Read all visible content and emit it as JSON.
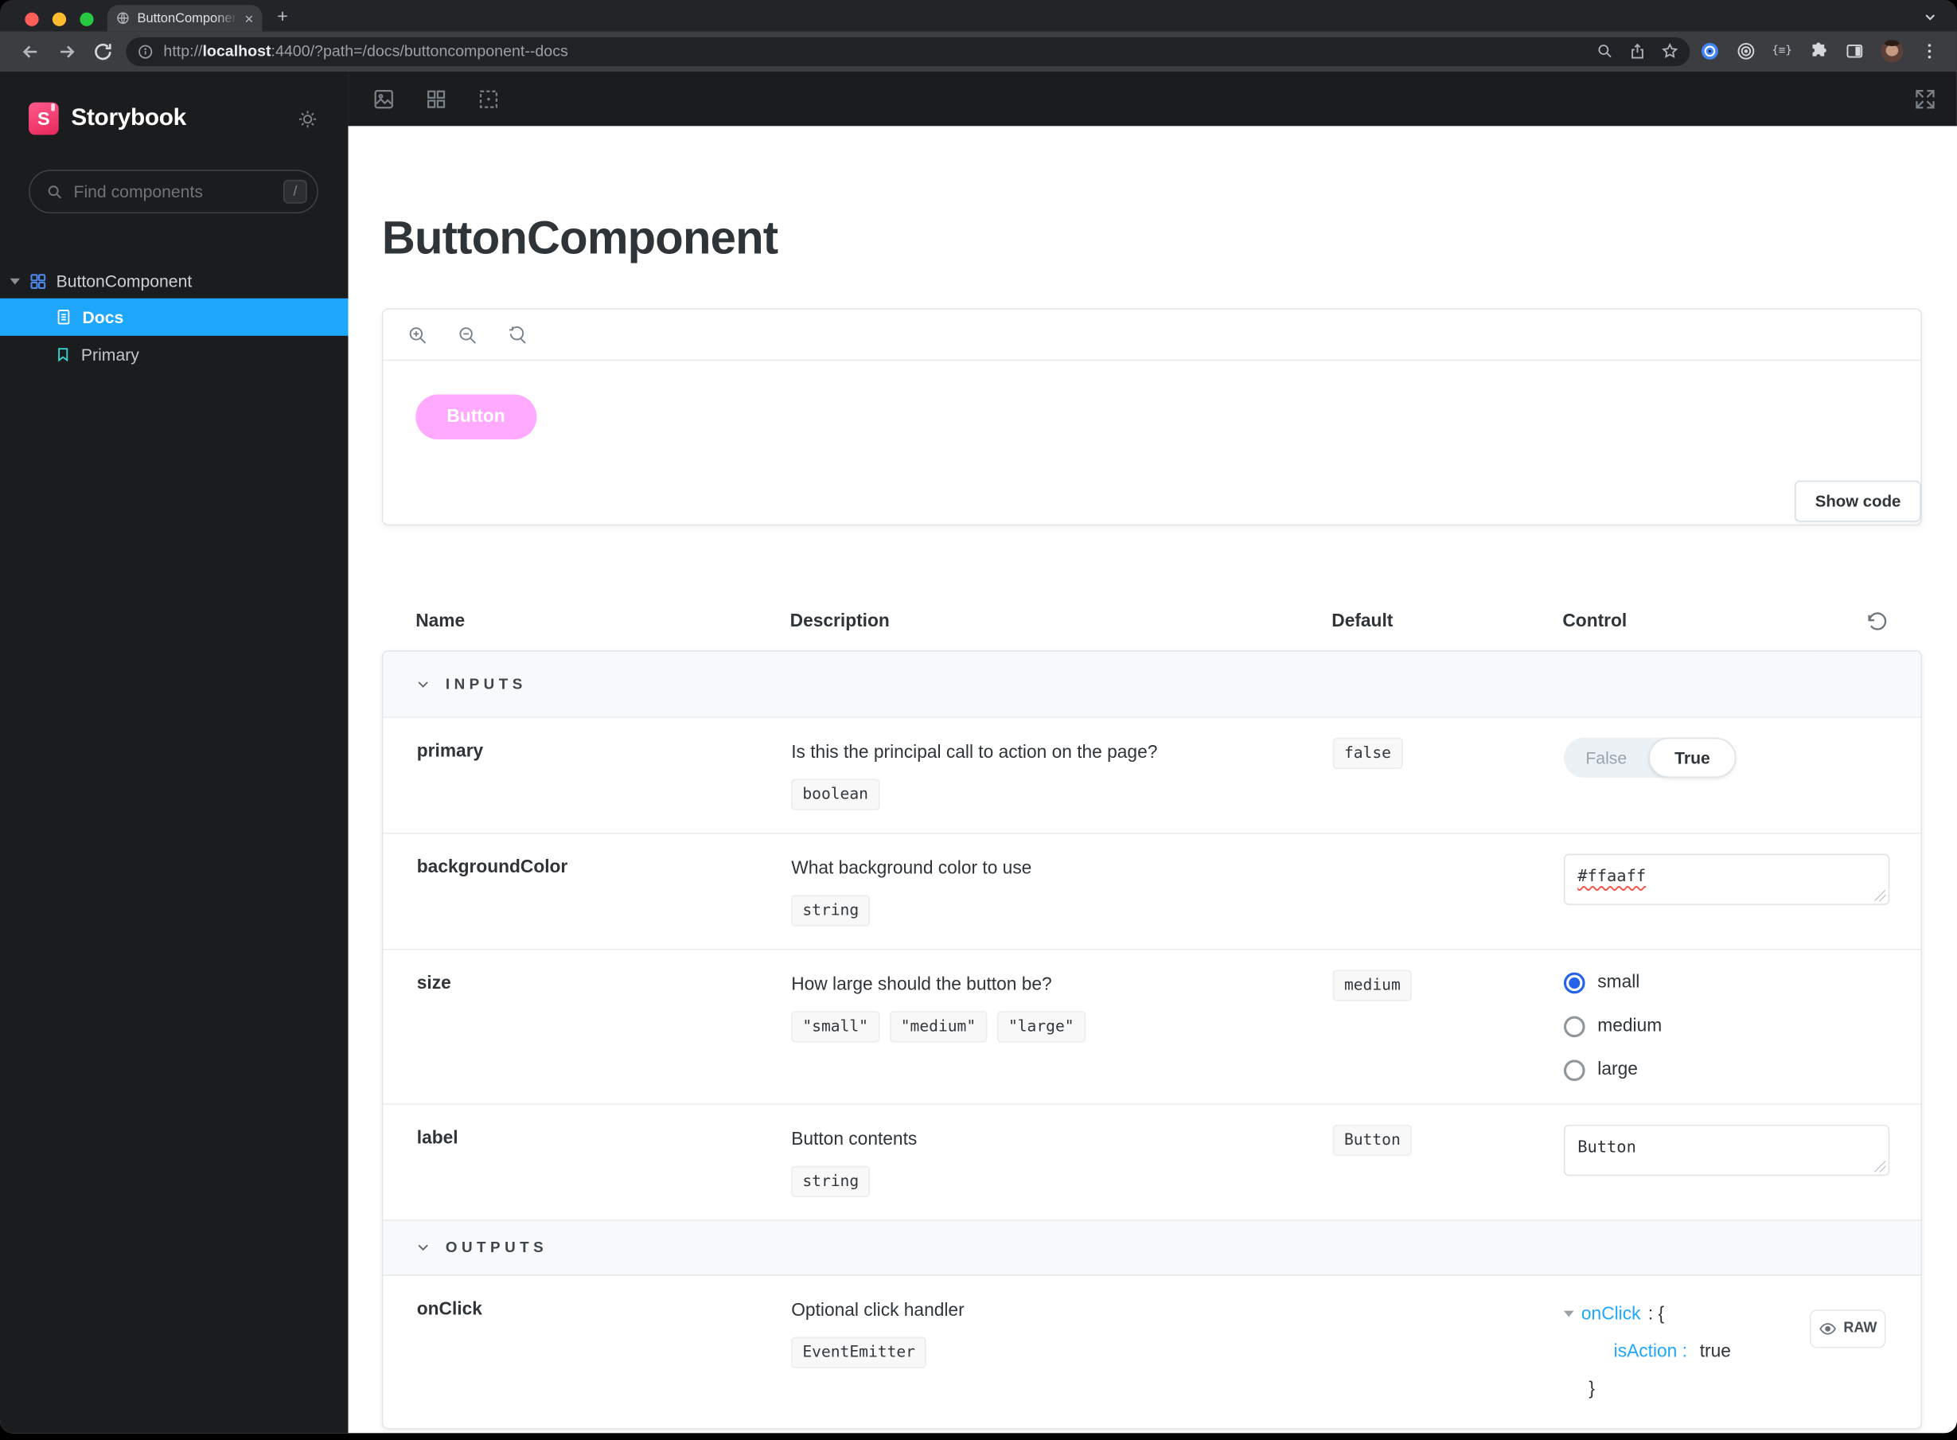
{
  "browser": {
    "tab_title": "ButtonComponent - Docs · Stor",
    "url_prefix": "http://",
    "url_host": "localhost",
    "url_rest": ":4400/?path=/docs/buttoncomponent--docs",
    "extension_badge": "{≡}",
    "close_glyph": "×",
    "newtab_glyph": "+"
  },
  "sidebar": {
    "brand": "Storybook",
    "search_placeholder": "Find components",
    "search_shortcut": "/",
    "root_item": "ButtonComponent",
    "docs_item": "Docs",
    "primary_item": "Primary"
  },
  "docs": {
    "title": "ButtonComponent",
    "preview_button_label": "Button",
    "show_code_label": "Show code"
  },
  "table": {
    "headers": {
      "name": "Name",
      "description": "Description",
      "default": "Default",
      "control": "Control"
    },
    "sections": {
      "inputs": "INPUTS",
      "outputs": "OUTPUTS"
    },
    "rows": {
      "primary": {
        "name": "primary",
        "description": "Is this the principal call to action on the page?",
        "type": "boolean",
        "default": "false",
        "toggle_false": "False",
        "toggle_true": "True"
      },
      "backgroundColor": {
        "name": "backgroundColor",
        "description": "What background color to use",
        "type": "string",
        "value": "#ffaaff"
      },
      "size": {
        "name": "size",
        "description": "How large should the button be?",
        "types": [
          "\"small\"",
          "\"medium\"",
          "\"large\""
        ],
        "default": "medium",
        "options": [
          "small",
          "medium",
          "large"
        ],
        "selected": "small"
      },
      "label": {
        "name": "label",
        "description": "Button contents",
        "type": "string",
        "default": "Button",
        "value": "Button"
      },
      "onClick": {
        "name": "onClick",
        "description": "Optional click handler",
        "type": "EventEmitter",
        "tree_key": "onClick",
        "tree_open": ": {",
        "entry_key": "isAction",
        "entry_sep": ":",
        "entry_value": "true",
        "tree_close": "}",
        "raw_label": "RAW"
      }
    }
  },
  "colors": {
    "accent": "#1EA7FD",
    "brand": "#FF4785",
    "button_background": "#ffaaff",
    "radio_checked": "#2563EB"
  }
}
